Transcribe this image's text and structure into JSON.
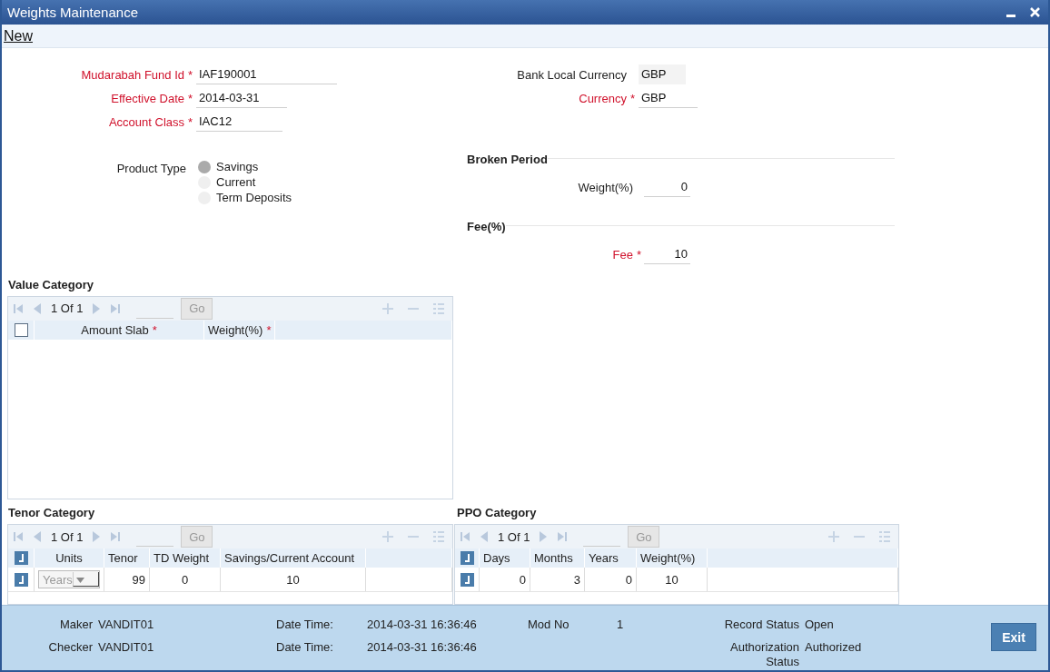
{
  "window": {
    "title": "Weights Maintenance"
  },
  "menu": [
    {
      "label": "New"
    }
  ],
  "main_fields": [
    {
      "label": "Mudarabah Fund Id",
      "mark": "*",
      "value": "IAF190001"
    },
    {
      "label": "Effective Date",
      "mark": "*",
      "value": "2014-03-31"
    },
    {
      "label": "Account Class",
      "mark": "*",
      "value": "IAC12"
    }
  ],
  "product_type": {
    "label": "Product Type",
    "options": [
      {
        "label": "Savings",
        "selected": true
      },
      {
        "label": "Current",
        "selected": false
      },
      {
        "label": "Term Deposits",
        "selected": false
      }
    ]
  },
  "currency_fields": [
    {
      "label": "Bank Local Currency",
      "value": "GBP",
      "disabled": true
    },
    {
      "label": "Currency",
      "mark": "*",
      "value": "GBP",
      "disabled": false
    }
  ],
  "broken_period": {
    "title": "Broken Period",
    "fields": [
      {
        "label": "Weight(%)",
        "value": "0"
      }
    ]
  },
  "fee": {
    "title": "Fee(%)",
    "fields": [
      {
        "label": "Fee",
        "mark": "*",
        "value": "10"
      }
    ]
  },
  "value_category": {
    "title": "Value Category",
    "pager": "1 Of 1",
    "go": "Go",
    "header_checked": false,
    "columns": [
      {
        "label": "Amount Slab",
        "mark": "*"
      },
      {
        "label": "Weight(%)",
        "mark": "*"
      }
    ]
  },
  "tenor_category": {
    "title": "Tenor Category",
    "pager": "1 Of 1",
    "go": "Go",
    "header_checked": true,
    "columns": [
      {
        "label": "Units"
      },
      {
        "label": "Tenor"
      },
      {
        "label": "TD Weight"
      },
      {
        "label": "Savings/Current Account"
      }
    ],
    "rows": [
      {
        "checked": true,
        "cells": [
          {
            "kind": "select",
            "value": "Years",
            "disabled": true
          },
          {
            "kind": "number",
            "value": "99"
          },
          {
            "kind": "number",
            "value": "0"
          },
          {
            "kind": "number",
            "value": "10"
          }
        ]
      }
    ]
  },
  "ppo_category": {
    "title": "PPO Category",
    "pager": "1 Of 1",
    "go": "Go",
    "header_checked": true,
    "columns": [
      {
        "label": "Days"
      },
      {
        "label": "Months"
      },
      {
        "label": "Years"
      },
      {
        "label": "Weight(%)"
      }
    ],
    "rows": [
      {
        "checked": true,
        "cells": [
          {
            "kind": "number",
            "value": "0"
          },
          {
            "kind": "number",
            "value": "3"
          },
          {
            "kind": "number",
            "value": "0"
          },
          {
            "kind": "number",
            "value": "10"
          }
        ]
      }
    ]
  },
  "footer": {
    "groups": [
      [
        {
          "label": "Maker",
          "value": "VANDIT01"
        },
        {
          "label": "Checker",
          "value": "VANDIT01"
        }
      ],
      [
        {
          "label": "Date Time:",
          "value": "2014-03-31 16:36:46"
        },
        {
          "label": "Date Time:",
          "value": "2014-03-31 16:36:46"
        }
      ],
      [
        {
          "label": "Mod No",
          "value": "1"
        }
      ],
      [
        {
          "label": "Record Status",
          "value": "Open"
        },
        {
          "label": "Authorization Status",
          "value": "Authorized"
        }
      ]
    ],
    "exit": "Exit"
  }
}
